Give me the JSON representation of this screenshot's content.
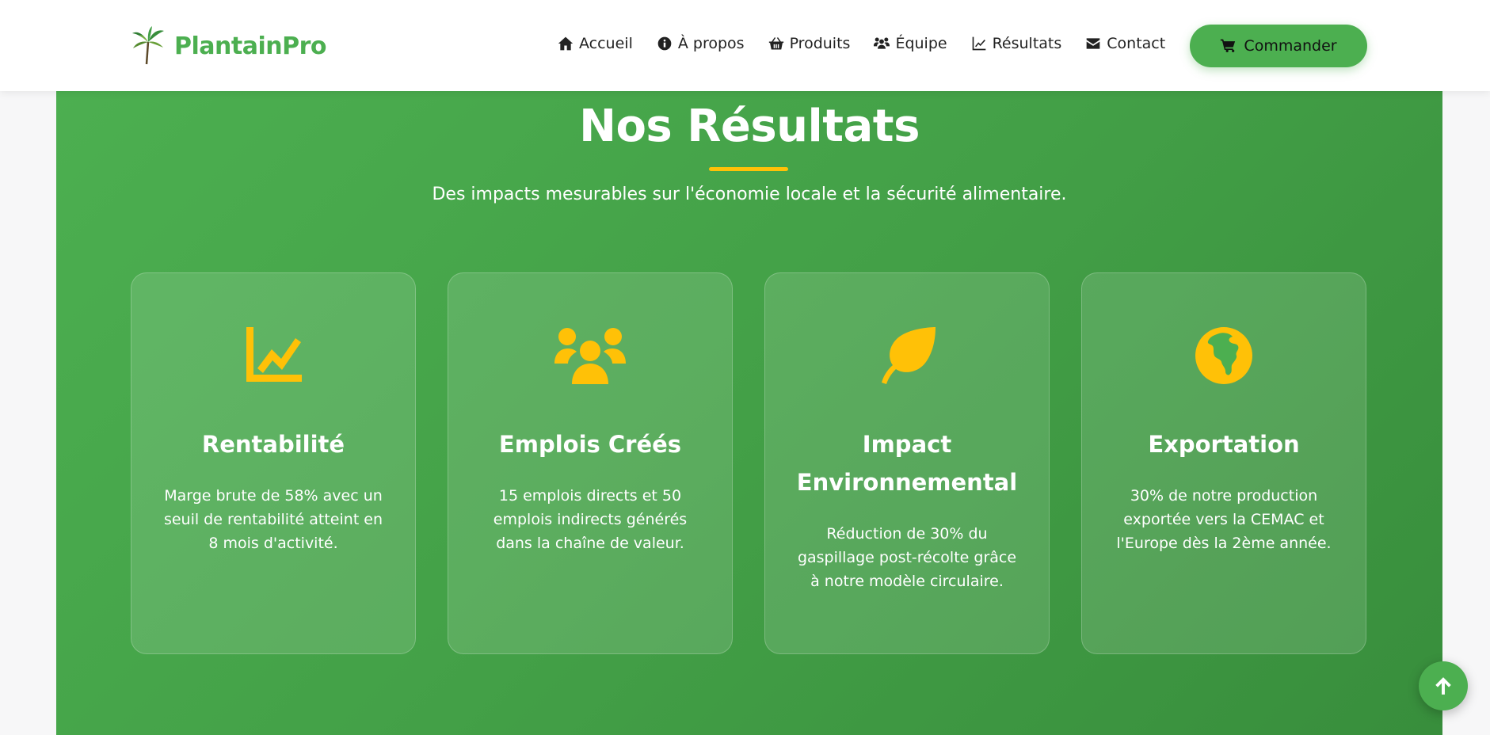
{
  "header": {
    "brand_name": "PlantainPro",
    "nav": [
      {
        "label": "Accueil",
        "icon": "home-icon"
      },
      {
        "label": "À propos",
        "icon": "info-icon"
      },
      {
        "label": "Produits",
        "icon": "basket-icon"
      },
      {
        "label": "Équipe",
        "icon": "users-icon"
      },
      {
        "label": "Résultats",
        "icon": "chart-line-icon"
      },
      {
        "label": "Contact",
        "icon": "envelope-icon"
      }
    ],
    "cta_label": "Commander",
    "cta_icon": "cart-icon"
  },
  "results": {
    "title": "Nos Résultats",
    "subtitle": "Des impacts mesurables sur l'économie locale et la sécurité alimentaire.",
    "cards": [
      {
        "icon": "chart-line-icon",
        "title": "Rentabilité",
        "text": "Marge brute de 58% avec un seuil de rentabilité atteint en 8 mois d'activité."
      },
      {
        "icon": "users-icon",
        "title": "Emplois Créés",
        "text": "15 emplois directs et 50 emplois indirects générés dans la chaîne de valeur."
      },
      {
        "icon": "leaf-icon",
        "title": "Impact Environnemental",
        "text": "Réduction de 30% du gaspillage post-récolte grâce à notre modèle circulaire."
      },
      {
        "icon": "globe-africa-icon",
        "title": "Exportation",
        "text": "30% de notre production exportée vers la CEMAC et l'Europe dès la 2ème année."
      }
    ]
  },
  "colors": {
    "brand_green": "#4caf50",
    "accent_yellow": "#ffc107",
    "white": "#ffffff"
  }
}
